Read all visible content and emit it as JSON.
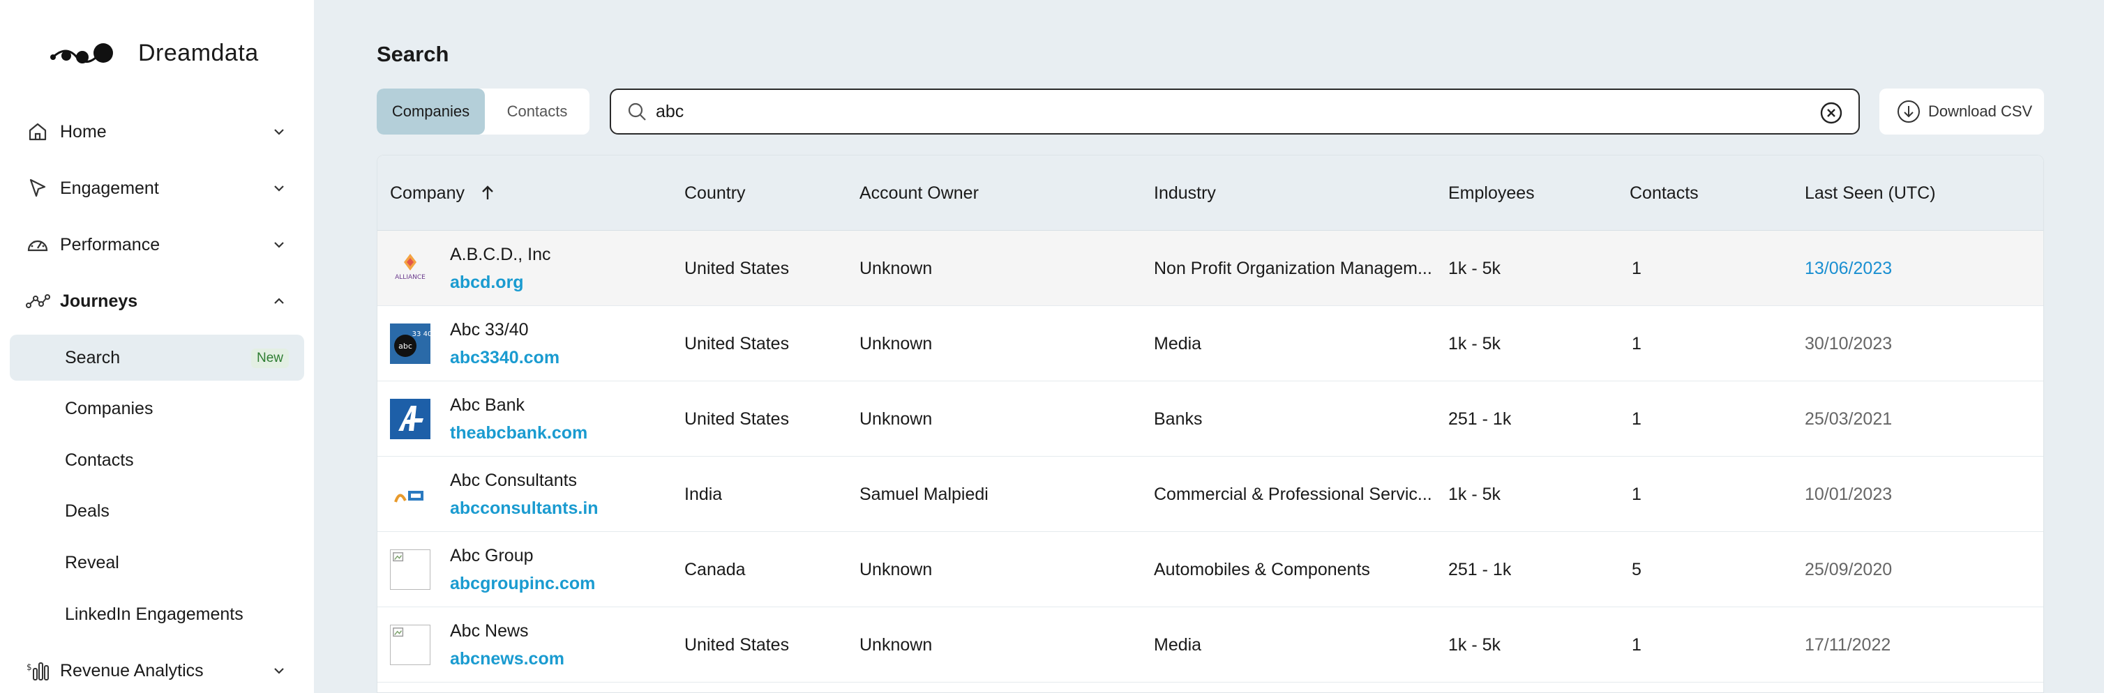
{
  "sidebar": {
    "brand": "Dreamdata",
    "nav": {
      "home": "Home",
      "engagement": "Engagement",
      "performance": "Performance",
      "journeys": "Journeys",
      "revenue": "Revenue Analytics"
    },
    "journeys_items": [
      {
        "label": "Search",
        "badge": "New"
      },
      {
        "label": "Companies"
      },
      {
        "label": "Contacts"
      },
      {
        "label": "Deals"
      },
      {
        "label": "Reveal"
      },
      {
        "label": "LinkedIn Engagements"
      }
    ]
  },
  "main": {
    "title": "Search",
    "tabs": [
      "Companies",
      "Contacts"
    ],
    "active_tab": "Companies",
    "search_value": "abc",
    "download_label": "Download CSV"
  },
  "table": {
    "headers": [
      "Company",
      "Country",
      "Account Owner",
      "Industry",
      "Employees",
      "Contacts",
      "Last Seen (UTC)"
    ],
    "sort": {
      "column": "Company",
      "direction": "ascending"
    },
    "rows": [
      {
        "name": "A.B.C.D., Inc",
        "domain": "abcd.org",
        "logo": "alliance-logo",
        "logo_text": "ALLIANCE",
        "country": "United States",
        "owner": "Unknown",
        "industry": "Non Profit Organization Managem...",
        "employees": "1k - 5k",
        "contacts": "1",
        "last_seen": "13/06/2023"
      },
      {
        "name": "Abc 33/40",
        "domain": "abc3340.com",
        "logo": "abc-3340-logo",
        "logo_text": "abc",
        "logo_sub": "33 40",
        "country": "United States",
        "owner": "Unknown",
        "industry": "Media",
        "employees": "1k - 5k",
        "contacts": "1",
        "last_seen": "30/10/2023"
      },
      {
        "name": "Abc Bank",
        "domain": "theabcbank.com",
        "logo": "abc-bank-logo",
        "country": "United States",
        "owner": "Unknown",
        "industry": "Banks",
        "employees": "251 - 1k",
        "contacts": "1",
        "last_seen": "25/03/2021"
      },
      {
        "name": "Abc Consultants",
        "domain": "abcconsultants.in",
        "logo": "abc-consultants-logo",
        "country": "India",
        "owner": "Samuel Malpiedi",
        "industry": "Commercial & Professional Servic...",
        "employees": "1k - 5k",
        "contacts": "1",
        "last_seen": "10/01/2023"
      },
      {
        "name": "Abc Group",
        "domain": "abcgroupinc.com",
        "logo": "broken-image-icon",
        "country": "Canada",
        "owner": "Unknown",
        "industry": "Automobiles & Components",
        "employees": "251 - 1k",
        "contacts": "5",
        "last_seen": "25/09/2020"
      },
      {
        "name": "Abc News",
        "domain": "abcnews.com",
        "logo": "broken-image-icon",
        "country": "United States",
        "owner": "Unknown",
        "industry": "Media",
        "employees": "1k - 5k",
        "contacts": "1",
        "last_seen": "17/11/2022"
      }
    ]
  },
  "colors": {
    "accent_link": "#1a9bd0",
    "active_tab": "#b4cfd9",
    "page_bg": "#e8eef2",
    "badge_green": "#2e7d32"
  }
}
